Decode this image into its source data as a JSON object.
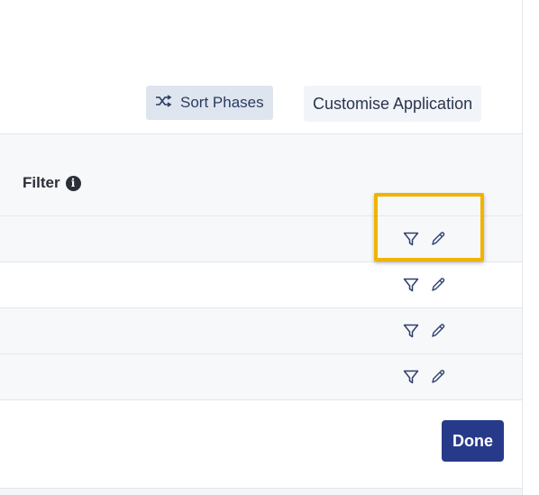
{
  "toolbar": {
    "sort_label": "Sort Phases",
    "sort_icon": "shuffle-icon",
    "customise_label": "Customise Application"
  },
  "table": {
    "header": {
      "filter_label": "Filter",
      "info_icon": "info-icon",
      "info_glyph": "i"
    },
    "rows": [
      {
        "filter_icon": "filter-icon",
        "edit_icon": "pencil-icon"
      },
      {
        "filter_icon": "filter-icon",
        "edit_icon": "pencil-icon"
      },
      {
        "filter_icon": "filter-icon",
        "edit_icon": "pencil-icon"
      },
      {
        "filter_icon": "filter-icon",
        "edit_icon": "pencil-icon"
      }
    ]
  },
  "footer": {
    "done_label": "Done"
  },
  "colors": {
    "primary": "#273a8a",
    "highlight": "#f0b400",
    "sort_bg": "#dfe5ee",
    "row_alt": "#f7f8fa"
  }
}
